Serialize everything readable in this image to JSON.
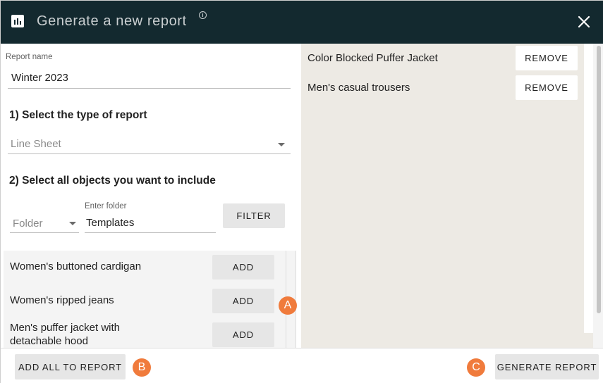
{
  "header": {
    "title": "Generate a new report",
    "info_icon_glyph": "i"
  },
  "form": {
    "report_name": {
      "label": "Report name",
      "value": "Winter 2023"
    },
    "section1_title": "1) Select the type of report",
    "report_type": {
      "value": "Line Sheet"
    },
    "section2_title": "2) Select all objects you want to include",
    "folder_select": {
      "value": "Folder"
    },
    "folder_input": {
      "label": "Enter folder",
      "value": "Templates"
    },
    "filter_label": "FILTER"
  },
  "available_objects": [
    {
      "name": "Women's buttoned cardigan",
      "action": "ADD"
    },
    {
      "name": "Women's ripped jeans",
      "action": "ADD"
    },
    {
      "name": "Men's puffer jacket with detachable hood",
      "action": "ADD"
    }
  ],
  "selected_objects": [
    {
      "name": "Color Blocked Puffer Jacket",
      "action": "REMOVE"
    },
    {
      "name": "Men's casual trousers",
      "action": "REMOVE"
    }
  ],
  "footer": {
    "add_all_label": "ADD ALL TO REPORT",
    "generate_label": "GENERATE REPORT"
  },
  "annotations": {
    "a": "A",
    "b": "B",
    "c": "C"
  },
  "colors": {
    "header_bg": "#13292f",
    "badge": "#f07b3c",
    "right_panel_bg": "#edeae4"
  }
}
